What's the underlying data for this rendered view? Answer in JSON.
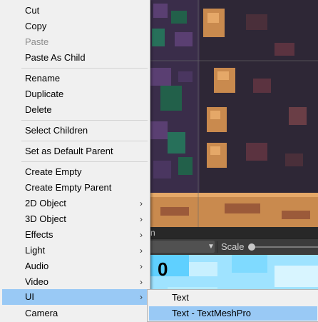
{
  "context_menu": {
    "items": [
      {
        "label": "Cut"
      },
      {
        "label": "Copy"
      },
      {
        "label": "Paste"
      },
      {
        "label": "Paste As Child"
      },
      {
        "label": "Rename"
      },
      {
        "label": "Duplicate"
      },
      {
        "label": "Delete"
      },
      {
        "label": "Select Children"
      },
      {
        "label": "Set as Default Parent"
      },
      {
        "label": "Create Empty"
      },
      {
        "label": "Create Empty Parent"
      },
      {
        "label": "2D Object"
      },
      {
        "label": "3D Object"
      },
      {
        "label": "Effects"
      },
      {
        "label": "Light"
      },
      {
        "label": "Audio"
      },
      {
        "label": "Video"
      },
      {
        "label": "UI"
      },
      {
        "label": "Camera"
      }
    ],
    "disabled_item": "Paste",
    "highlighted_item": "UI",
    "submenu_arrow_icon": "chevron-right-icon"
  },
  "ui_submenu": {
    "items": [
      {
        "label": "Text"
      },
      {
        "label": "Text - TextMeshPro"
      }
    ],
    "highlighted_item": "Text - TextMeshPro"
  },
  "viewport": {
    "tab_fragment": "n",
    "scale_label": "Scale",
    "dropdown_arrow_icon": "caret-down-icon"
  },
  "game_view": {
    "score": "0"
  },
  "colors": {
    "menu_bg": "#f0f0f0",
    "highlight": "#99c9f5",
    "disabled_text": "#8d8d8d",
    "game_bg": "#9fe3ff"
  }
}
